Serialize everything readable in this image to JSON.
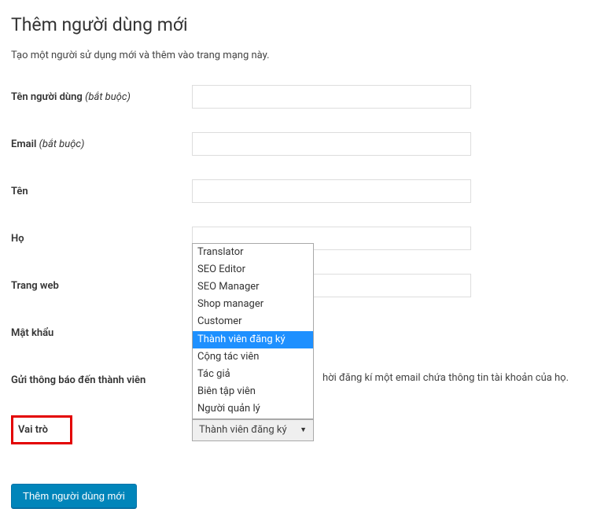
{
  "page": {
    "title": "Thêm người dùng mới",
    "description": "Tạo một người sử dụng mới và thêm vào trang mạng này."
  },
  "form": {
    "username_label": "Tên người dùng ",
    "username_required": "(bắt buộc)",
    "email_label": "Email ",
    "email_required": "(bắt buộc)",
    "firstname_label": "Tên",
    "lastname_label": "Họ",
    "website_label": "Trang web",
    "password_label": "Mật khẩu",
    "notification_label": "Gửi thông báo đến thành viên",
    "notification_partial": "hời đăng kí một email chứa thông tin tài khoản của họ.",
    "role_label": "Vai trò",
    "role_selected": "Thành viên đăng ký",
    "submit_label": "Thêm người dùng mới"
  },
  "dropdown": {
    "options": [
      "Translator",
      "SEO Editor",
      "SEO Manager",
      "Shop manager",
      "Customer",
      "Thành viên đăng ký",
      "Cộng tác viên",
      "Tác giả",
      "Biên tập viên",
      "Người quản lý"
    ],
    "selected_index": 5
  }
}
